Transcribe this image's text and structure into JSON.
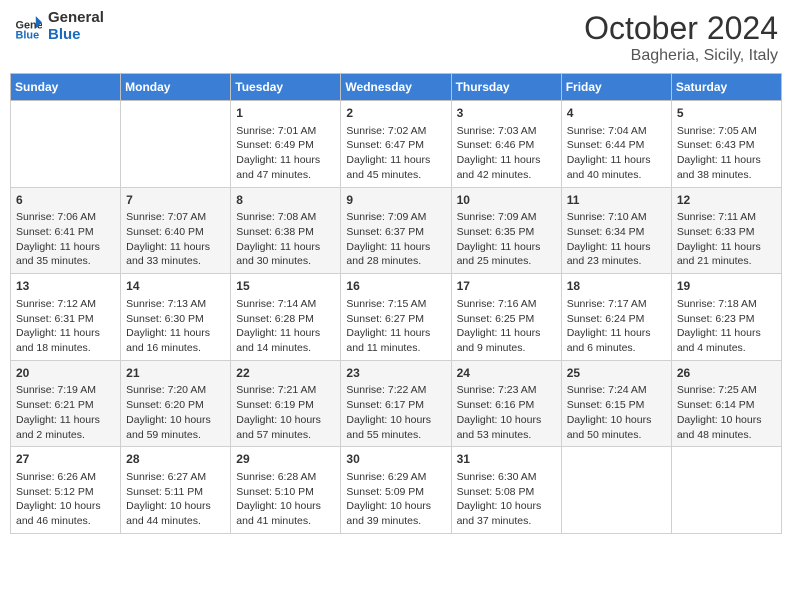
{
  "header": {
    "logo_line1": "General",
    "logo_line2": "Blue",
    "title": "October 2024",
    "subtitle": "Bagheria, Sicily, Italy"
  },
  "weekdays": [
    "Sunday",
    "Monday",
    "Tuesday",
    "Wednesday",
    "Thursday",
    "Friday",
    "Saturday"
  ],
  "weeks": [
    [
      {
        "day": "",
        "info": ""
      },
      {
        "day": "",
        "info": ""
      },
      {
        "day": "1",
        "info": "Sunrise: 7:01 AM\nSunset: 6:49 PM\nDaylight: 11 hours and 47 minutes."
      },
      {
        "day": "2",
        "info": "Sunrise: 7:02 AM\nSunset: 6:47 PM\nDaylight: 11 hours and 45 minutes."
      },
      {
        "day": "3",
        "info": "Sunrise: 7:03 AM\nSunset: 6:46 PM\nDaylight: 11 hours and 42 minutes."
      },
      {
        "day": "4",
        "info": "Sunrise: 7:04 AM\nSunset: 6:44 PM\nDaylight: 11 hours and 40 minutes."
      },
      {
        "day": "5",
        "info": "Sunrise: 7:05 AM\nSunset: 6:43 PM\nDaylight: 11 hours and 38 minutes."
      }
    ],
    [
      {
        "day": "6",
        "info": "Sunrise: 7:06 AM\nSunset: 6:41 PM\nDaylight: 11 hours and 35 minutes."
      },
      {
        "day": "7",
        "info": "Sunrise: 7:07 AM\nSunset: 6:40 PM\nDaylight: 11 hours and 33 minutes."
      },
      {
        "day": "8",
        "info": "Sunrise: 7:08 AM\nSunset: 6:38 PM\nDaylight: 11 hours and 30 minutes."
      },
      {
        "day": "9",
        "info": "Sunrise: 7:09 AM\nSunset: 6:37 PM\nDaylight: 11 hours and 28 minutes."
      },
      {
        "day": "10",
        "info": "Sunrise: 7:09 AM\nSunset: 6:35 PM\nDaylight: 11 hours and 25 minutes."
      },
      {
        "day": "11",
        "info": "Sunrise: 7:10 AM\nSunset: 6:34 PM\nDaylight: 11 hours and 23 minutes."
      },
      {
        "day": "12",
        "info": "Sunrise: 7:11 AM\nSunset: 6:33 PM\nDaylight: 11 hours and 21 minutes."
      }
    ],
    [
      {
        "day": "13",
        "info": "Sunrise: 7:12 AM\nSunset: 6:31 PM\nDaylight: 11 hours and 18 minutes."
      },
      {
        "day": "14",
        "info": "Sunrise: 7:13 AM\nSunset: 6:30 PM\nDaylight: 11 hours and 16 minutes."
      },
      {
        "day": "15",
        "info": "Sunrise: 7:14 AM\nSunset: 6:28 PM\nDaylight: 11 hours and 14 minutes."
      },
      {
        "day": "16",
        "info": "Sunrise: 7:15 AM\nSunset: 6:27 PM\nDaylight: 11 hours and 11 minutes."
      },
      {
        "day": "17",
        "info": "Sunrise: 7:16 AM\nSunset: 6:25 PM\nDaylight: 11 hours and 9 minutes."
      },
      {
        "day": "18",
        "info": "Sunrise: 7:17 AM\nSunset: 6:24 PM\nDaylight: 11 hours and 6 minutes."
      },
      {
        "day": "19",
        "info": "Sunrise: 7:18 AM\nSunset: 6:23 PM\nDaylight: 11 hours and 4 minutes."
      }
    ],
    [
      {
        "day": "20",
        "info": "Sunrise: 7:19 AM\nSunset: 6:21 PM\nDaylight: 11 hours and 2 minutes."
      },
      {
        "day": "21",
        "info": "Sunrise: 7:20 AM\nSunset: 6:20 PM\nDaylight: 10 hours and 59 minutes."
      },
      {
        "day": "22",
        "info": "Sunrise: 7:21 AM\nSunset: 6:19 PM\nDaylight: 10 hours and 57 minutes."
      },
      {
        "day": "23",
        "info": "Sunrise: 7:22 AM\nSunset: 6:17 PM\nDaylight: 10 hours and 55 minutes."
      },
      {
        "day": "24",
        "info": "Sunrise: 7:23 AM\nSunset: 6:16 PM\nDaylight: 10 hours and 53 minutes."
      },
      {
        "day": "25",
        "info": "Sunrise: 7:24 AM\nSunset: 6:15 PM\nDaylight: 10 hours and 50 minutes."
      },
      {
        "day": "26",
        "info": "Sunrise: 7:25 AM\nSunset: 6:14 PM\nDaylight: 10 hours and 48 minutes."
      }
    ],
    [
      {
        "day": "27",
        "info": "Sunrise: 6:26 AM\nSunset: 5:12 PM\nDaylight: 10 hours and 46 minutes."
      },
      {
        "day": "28",
        "info": "Sunrise: 6:27 AM\nSunset: 5:11 PM\nDaylight: 10 hours and 44 minutes."
      },
      {
        "day": "29",
        "info": "Sunrise: 6:28 AM\nSunset: 5:10 PM\nDaylight: 10 hours and 41 minutes."
      },
      {
        "day": "30",
        "info": "Sunrise: 6:29 AM\nSunset: 5:09 PM\nDaylight: 10 hours and 39 minutes."
      },
      {
        "day": "31",
        "info": "Sunrise: 6:30 AM\nSunset: 5:08 PM\nDaylight: 10 hours and 37 minutes."
      },
      {
        "day": "",
        "info": ""
      },
      {
        "day": "",
        "info": ""
      }
    ]
  ]
}
